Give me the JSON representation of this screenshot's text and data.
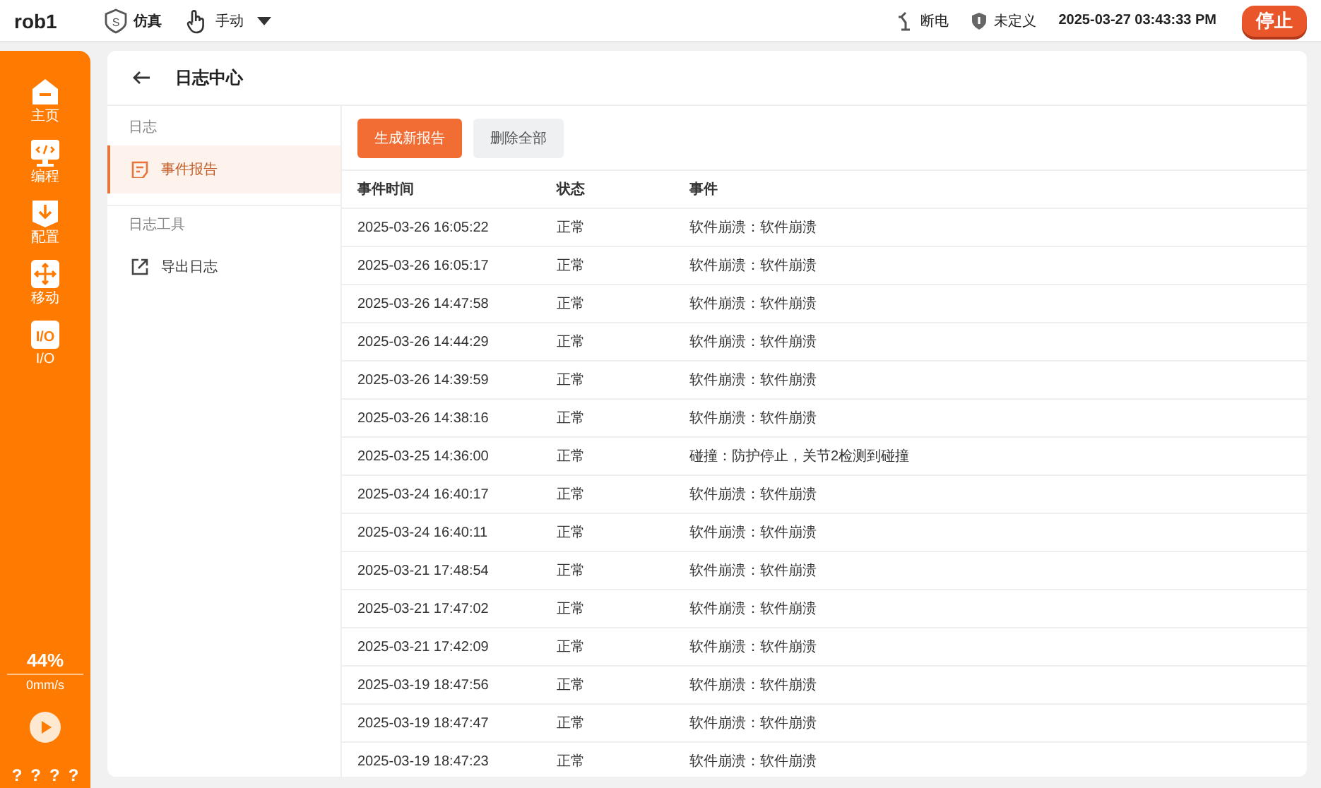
{
  "top_bar": {
    "robot": "rob1",
    "mode_badge": "S",
    "mode": "仿真",
    "control": "手动",
    "power": "断电",
    "safety": "未定义",
    "datetime": "2025-03-27 03:43:33 PM",
    "stop_button": "停止"
  },
  "nav": {
    "items": [
      {
        "kind": "home",
        "label": "主页"
      },
      {
        "kind": "code",
        "label": "编程"
      },
      {
        "kind": "config",
        "label": "配置"
      },
      {
        "kind": "move",
        "label": "移动"
      },
      {
        "kind": "io",
        "icon_text": "I/O",
        "label": "I/O"
      }
    ],
    "speed_percent": "44%",
    "speed": "0mm/s",
    "help": [
      "?",
      "?",
      "?",
      "?"
    ]
  },
  "page": {
    "title": "日志中心"
  },
  "menu": [
    {
      "heading": "日志",
      "items": [
        {
          "kind": "report",
          "label": "事件报告",
          "selected": true
        }
      ]
    },
    {
      "heading": "日志工具",
      "items": [
        {
          "kind": "export",
          "label": "导出日志",
          "selected": false
        }
      ]
    }
  ],
  "actions": [
    {
      "kind": "primary",
      "label": "生成新报告"
    },
    {
      "kind": "secondary",
      "label": "删除全部"
    }
  ],
  "table": {
    "columns": [
      "事件时间",
      "状态",
      "事件"
    ],
    "rows": [
      [
        "2025-03-26 16:05:22",
        "正常",
        "软件崩溃：软件崩溃"
      ],
      [
        "2025-03-26 16:05:17",
        "正常",
        "软件崩溃：软件崩溃"
      ],
      [
        "2025-03-26 14:47:58",
        "正常",
        "软件崩溃：软件崩溃"
      ],
      [
        "2025-03-26 14:44:29",
        "正常",
        "软件崩溃：软件崩溃"
      ],
      [
        "2025-03-26 14:39:59",
        "正常",
        "软件崩溃：软件崩溃"
      ],
      [
        "2025-03-26 14:38:16",
        "正常",
        "软件崩溃：软件崩溃"
      ],
      [
        "2025-03-25 14:36:00",
        "正常",
        "碰撞：防护停止，关节2检测到碰撞"
      ],
      [
        "2025-03-24 16:40:17",
        "正常",
        "软件崩溃：软件崩溃"
      ],
      [
        "2025-03-24 16:40:11",
        "正常",
        "软件崩溃：软件崩溃"
      ],
      [
        "2025-03-21 17:48:54",
        "正常",
        "软件崩溃：软件崩溃"
      ],
      [
        "2025-03-21 17:47:02",
        "正常",
        "软件崩溃：软件崩溃"
      ],
      [
        "2025-03-21 17:42:09",
        "正常",
        "软件崩溃：软件崩溃"
      ],
      [
        "2025-03-19 18:47:56",
        "正常",
        "软件崩溃：软件崩溃"
      ],
      [
        "2025-03-19 18:47:47",
        "正常",
        "软件崩溃：软件崩溃"
      ],
      [
        "2025-03-19 18:47:23",
        "正常",
        "软件崩溃：软件崩溃"
      ]
    ]
  }
}
